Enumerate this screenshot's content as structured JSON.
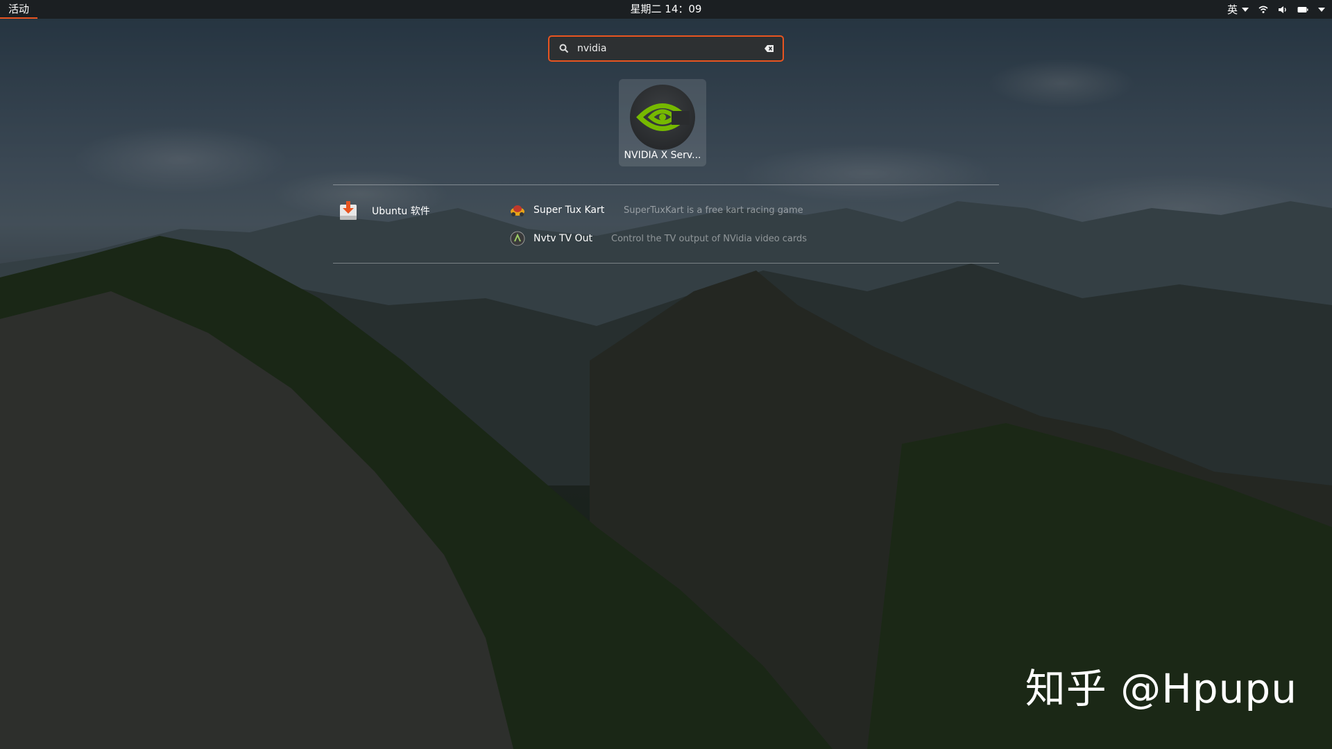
{
  "topbar": {
    "activities": "活动",
    "clock": "星期二 14：09",
    "input_language": "英",
    "tray_icons": [
      "wifi-icon",
      "volume-icon",
      "battery-icon",
      "chevron-down-icon"
    ]
  },
  "search": {
    "value": "nvidia",
    "icon": "search-icon",
    "clear_icon": "clear-icon"
  },
  "app_results": [
    {
      "name": "NVIDIA X Serv...",
      "icon": "nvidia-icon"
    }
  ],
  "provider": {
    "label": "Ubuntu 软件",
    "icon": "software-icon",
    "results": [
      {
        "name": "Super Tux Kart",
        "description": "SuperTuxKart is a free kart racing game",
        "icon": "supertuxkart-icon"
      },
      {
        "name": "Nvtv TV Out",
        "description": "Control the TV output of NVidia video cards",
        "icon": "nvtv-icon"
      }
    ]
  },
  "watermark": "知乎 @Hpupu",
  "colors": {
    "accent": "#e95420",
    "nvidia_green": "#76b900",
    "topbar": "#1b1f22"
  }
}
